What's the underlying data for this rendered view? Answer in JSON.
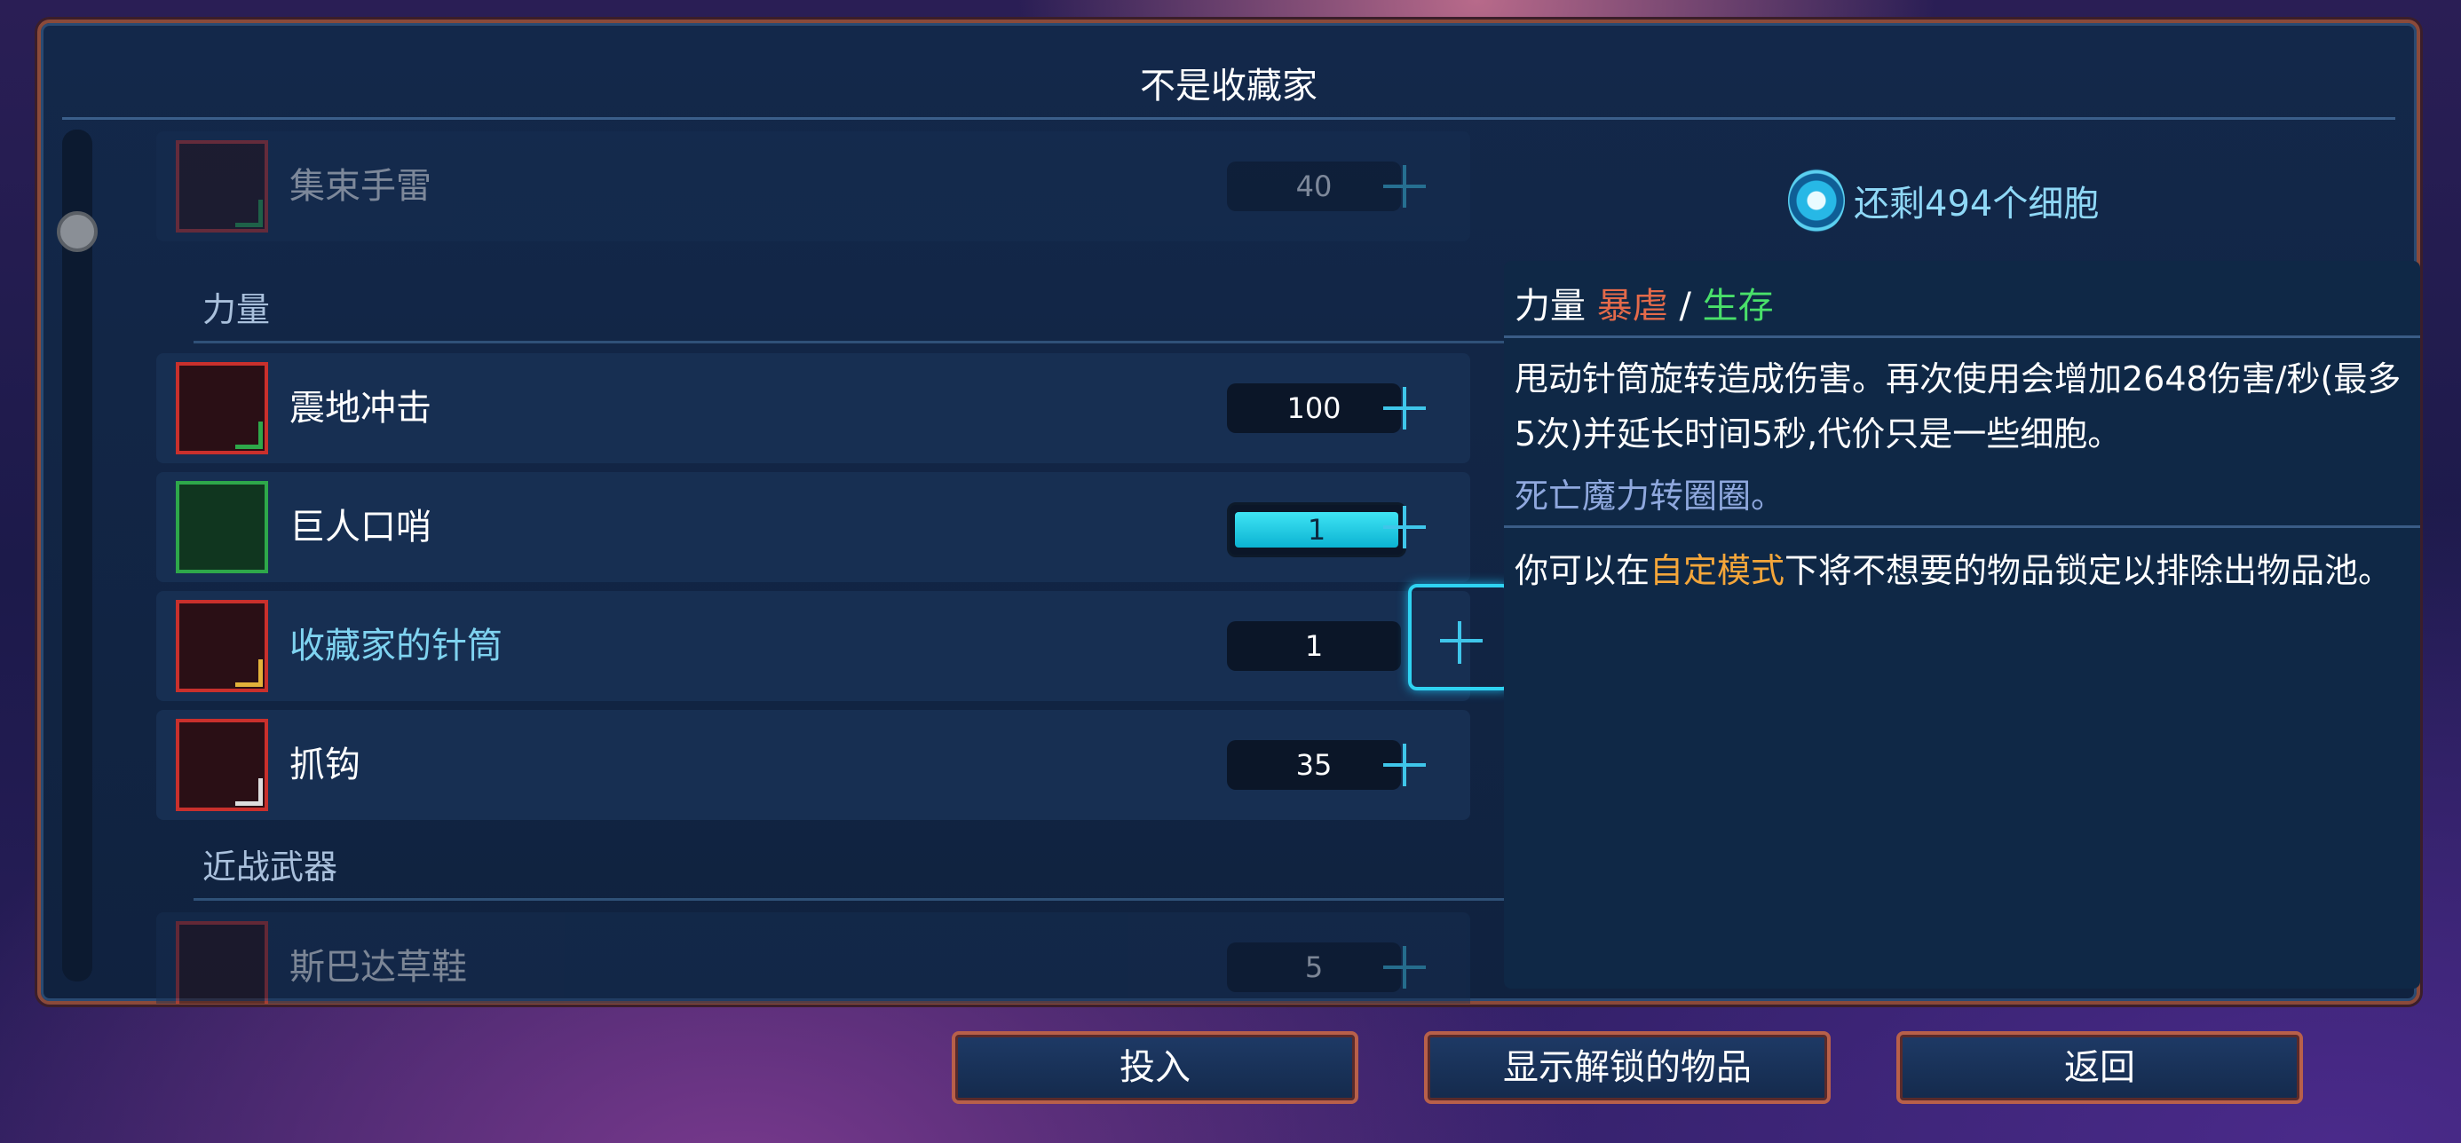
{
  "window": {
    "title": "不是收藏家"
  },
  "list": {
    "top_item": {
      "name": "集束手雷",
      "cost": "40"
    },
    "sections": [
      {
        "label": "力量",
        "items": [
          {
            "name": "震地冲击",
            "cost": "100"
          },
          {
            "name": "巨人口哨",
            "cost": "1"
          },
          {
            "name": "收藏家的针筒",
            "cost": "1"
          },
          {
            "name": "抓钩",
            "cost": "35"
          }
        ]
      },
      {
        "label": "近战武器",
        "items": [
          {
            "name": "斯巴达草鞋",
            "cost": "5"
          }
        ]
      }
    ],
    "purchase_progress": 1.0
  },
  "info": {
    "cells_remaining": "还剩494个细胞",
    "tag_primary": "力量",
    "tag_red": "暴虐",
    "tag_separator": "/",
    "tag_green": "生存",
    "description": "甩动针筒旋转造成伤害。再次使用会增加2648伤害/秒(最多5次)并延长时间5秒,代价只是一些细胞。",
    "flavor": "死亡魔力转圈圈。",
    "hint_pre": "你可以在",
    "hint_accent": "自定模式",
    "hint_post": "下将不想要的物品锁定以排除出物品池。"
  },
  "buttons": {
    "invest": "投入",
    "show_unlocked": "显示解锁的物品",
    "back": "返回"
  },
  "colors": {
    "accent_cyan": "#2fd3f2",
    "brutality_red": "#e46a4a",
    "survival_green": "#49e06a",
    "hint_orange": "#f4a63a"
  }
}
